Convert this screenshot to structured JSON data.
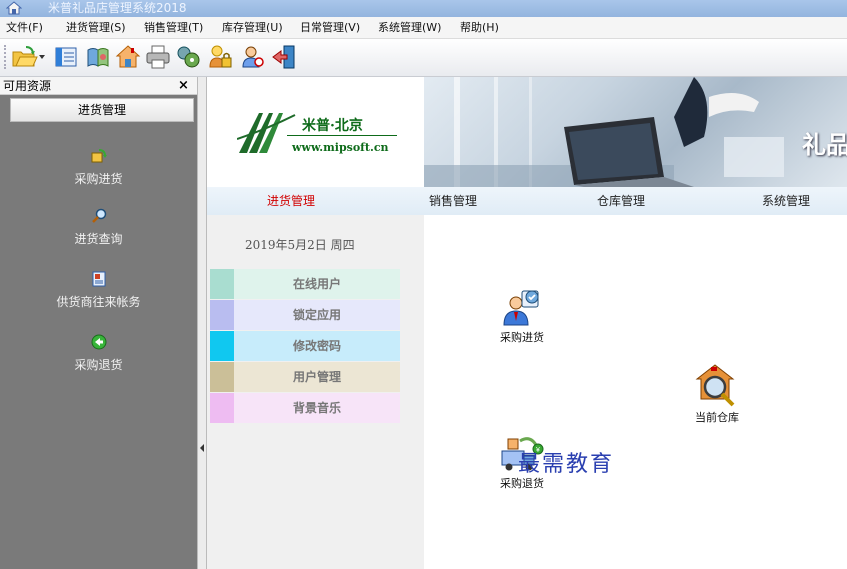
{
  "window": {
    "title": "米普礼品店管理系统2018"
  },
  "menubar": {
    "items": [
      {
        "label": "文件(F)"
      },
      {
        "label": "进货管理(S)"
      },
      {
        "label": "销售管理(T)"
      },
      {
        "label": "库存管理(U)"
      },
      {
        "label": "日常管理(V)"
      },
      {
        "label": "系统管理(W)"
      },
      {
        "label": "帮助(H)"
      }
    ]
  },
  "toolbar": {
    "buttons": [
      {
        "icon": "open-folder-icon"
      },
      {
        "icon": "list-view-icon"
      },
      {
        "icon": "book-icon"
      },
      {
        "icon": "home-icon"
      },
      {
        "icon": "print-icon"
      },
      {
        "icon": "tools-icon"
      },
      {
        "icon": "lock-icon"
      },
      {
        "icon": "user-icon"
      },
      {
        "icon": "exit-icon"
      }
    ]
  },
  "sidepanel": {
    "title": "可用资源",
    "close": "×",
    "group": "进货管理",
    "items": [
      {
        "label": "采购进货",
        "icon": "purchase-stock-icon"
      },
      {
        "label": "进货查询",
        "icon": "search-icon"
      },
      {
        "label": "供货商往来帐务",
        "icon": "supplier-ledger-icon"
      },
      {
        "label": "采购退货",
        "icon": "return-arrow-icon"
      }
    ]
  },
  "banner": {
    "brand": "米普·北京",
    "url": "www.mipsoft.cn",
    "slogan": "礼品"
  },
  "nav": {
    "tabs": [
      {
        "label": "进货管理",
        "active": true
      },
      {
        "label": "销售管理",
        "active": false
      },
      {
        "label": "仓库管理",
        "active": false
      },
      {
        "label": "系统管理",
        "active": false
      }
    ]
  },
  "leftcol": {
    "date": "2019年5月2日  周四",
    "quick_links": [
      {
        "label": "在线用户",
        "swatch": "#a9ddd0",
        "bg": "#dff3ec"
      },
      {
        "label": "锁定应用",
        "swatch": "#b9bdf0",
        "bg": "#e6e8fb"
      },
      {
        "label": "修改密码",
        "swatch": "#10c8f0",
        "bg": "#c7ecfb"
      },
      {
        "label": "用户管理",
        "swatch": "#cbbf98",
        "bg": "#ece6d4"
      },
      {
        "label": "背景音乐",
        "swatch": "#eebcf2",
        "bg": "#f7e4f8"
      }
    ]
  },
  "workarea": {
    "tiles": [
      {
        "label": "采购进货",
        "icon": "purchase-person-icon"
      },
      {
        "label": "当前仓库",
        "icon": "warehouse-search-icon"
      },
      {
        "label": "采购退货",
        "icon": "return-truck-icon"
      }
    ]
  },
  "watermark": "最需教育",
  "colors": {
    "accent_active": "#d10000",
    "brand_green": "#0e6b1a",
    "side_bg": "#7a7a7a"
  }
}
